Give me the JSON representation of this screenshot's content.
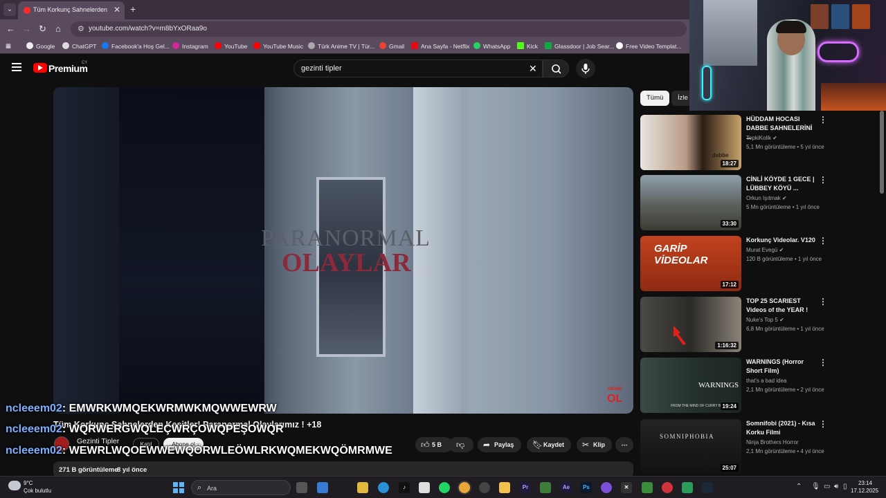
{
  "browser": {
    "tab_title": "Tüm Korkunç Sahnelerden Kesitler",
    "url": "youtube.com/watch?v=m8bYxORaa9o",
    "bookmarks": [
      "Google",
      "ChatGPT",
      "Facebook'a Hoş Gel...",
      "Instagram",
      "YouTube",
      "YouTube Music",
      "Türk Anime TV | Tür...",
      "Gmail",
      "Ana Sayfa - Netflix",
      "WhatsApp",
      "Kick",
      "Glassdoor | Job Sear...",
      "Free Video Templat..."
    ]
  },
  "youtube": {
    "logo_text": "Premium",
    "country_code": "CY",
    "search_query": "gezinti tipler"
  },
  "player": {
    "overlay_line1": "PARANORMAL",
    "overlay_line2": "OLAYLAR",
    "badge": "OL"
  },
  "video": {
    "title": "Tüm Korkunç Sahnelerden Kesitler! Paranormal Olaylarımız ! +18",
    "channel": "Gezinti Tipler",
    "join": "Katıl",
    "subscribe": "Abone ol",
    "likes": "5 B",
    "share": "Paylaş",
    "save": "Kaydet",
    "clip": "Klip",
    "views": "271 B görüntüleme",
    "age": "8 yıl önce"
  },
  "chat": [
    {
      "user": "ncleeem02",
      "msg": ": EMWRKWMQEKWRMWKMQWWEWRW"
    },
    {
      "user": "ncleeem02",
      "msg": ": WQRWERGWQLEÇWRÇOWQPEŞOWQR"
    },
    {
      "user": "ncleeem02",
      "msg": ": WEWRLWQOEWWEWQÖRWLEÖWLRKWQMEKWQÖMRMWE"
    }
  ],
  "chips": [
    "Tümü",
    "İzle"
  ],
  "recommendations": [
    {
      "title": "HÜDDAM HOCASI DABBE SAHNELERİNİ ...",
      "channel": "TepkiKolik",
      "views": "5,1 Mn görüntüleme",
      "age": "5 yıl önce",
      "duration": "18:27",
      "thumb_color": "#5a4a3c"
    },
    {
      "title": "CİNLİ KÖYDE 1 GECE | LÜBBEY KÖYÜ ...",
      "channel": "Orkun Işıtmak",
      "views": "5 Mn görüntüleme",
      "age": "1 yıl önce",
      "duration": "33:30",
      "thumb_color": "#4b4e50"
    },
    {
      "title": "Korkunç Videolar. V120",
      "channel": "Murat Evegü",
      "views": "120 B görüntüleme",
      "age": "1 yıl önce",
      "duration": "17:12",
      "thumb_color": "#b5331c"
    },
    {
      "title": "TOP 25 SCARIEST Videos of the YEAR !",
      "channel": "Nuke's Top 5",
      "views": "6,8 Mn görüntüleme",
      "age": "1 yıl önce",
      "duration": "1:16:32",
      "thumb_color": "#3d3a35"
    },
    {
      "title": "WARNINGS (Horror Short Film)",
      "channel": "that's a bad idea",
      "views": "2,1 Mn görüntüleme",
      "age": "2 yıl önce",
      "duration": "19:24",
      "thumb_color": "#2e3b36"
    },
    {
      "title": "Somnifobi (2021) - Kısa Korku Filmi",
      "channel": "Ninja Brothers Horror",
      "views": "2,1 Mn görüntüleme",
      "age": "4 yıl önce",
      "duration": "25:07",
      "thumb_color": "#1c1c1c"
    }
  ],
  "thumb_texts": {
    "t1": "dabbe",
    "t3": "GARİP VİDEOLAR",
    "t5": "WARNINGS",
    "t5_sub": "FROM THE MIND OF CURRY B",
    "t6": "SOMNIPHOBIA"
  },
  "taskbar": {
    "temp": "9°C",
    "weather": "Çok bulutlu",
    "search_placeholder": "Ara",
    "time": "23:14",
    "date": "17.12.2025"
  }
}
